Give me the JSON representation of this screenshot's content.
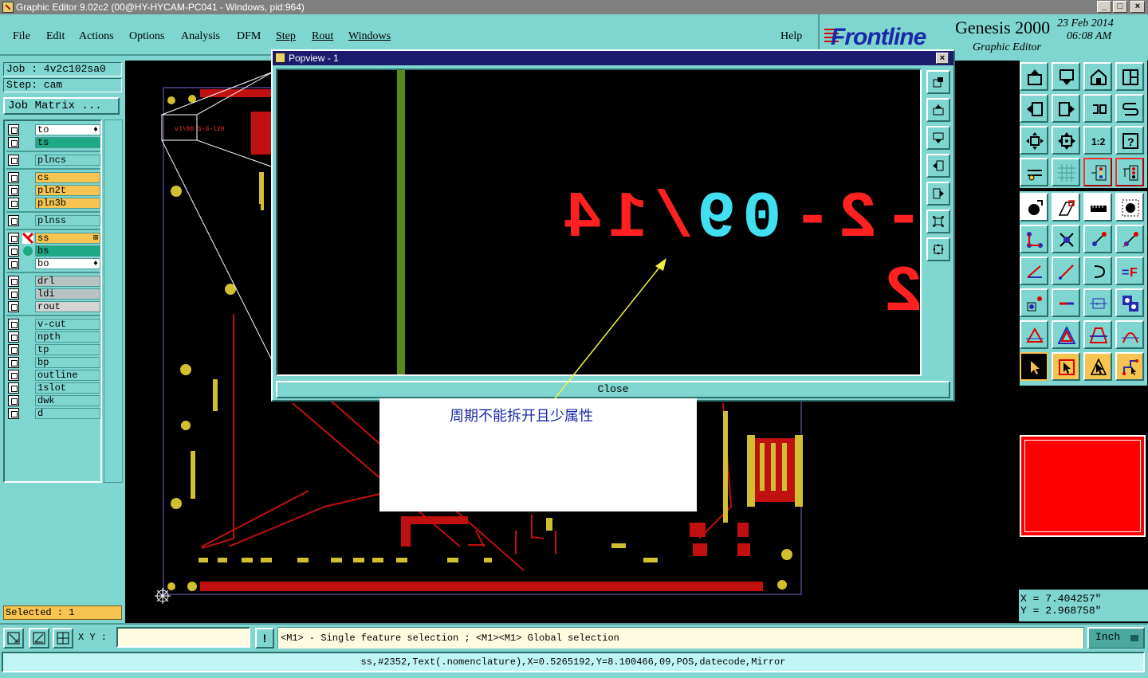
{
  "window": {
    "title": "Graphic Editor 9.02c2 (00@HY-HYCAM-PC041 - Windows, pid:964)",
    "minimize": "_",
    "maximize": "□",
    "close": "×"
  },
  "menu": {
    "items": [
      "File",
      "Edit",
      "Actions",
      "Options",
      "Analysis",
      "DFM",
      "Step",
      "Rout",
      "Windows"
    ],
    "help": "Help"
  },
  "brand": {
    "logo": "Frontline",
    "product": "Genesis 2000",
    "subtitle": "Graphic Editor",
    "date": "23 Feb 2014",
    "time": "06:08 AM"
  },
  "job": {
    "job_label": "Job : 4v2c102sa0",
    "step_label": "Step: cam",
    "matrix_button": "Job Matrix ..."
  },
  "layers": [
    {
      "name": "to",
      "color": "#ffffff",
      "end": "♦"
    },
    {
      "name": "ts",
      "color": "#1fa884",
      "end": ""
    },
    {
      "name": "plncs",
      "color": "#7fd6d0",
      "end": ""
    },
    {
      "name": "cs",
      "color": "#f5c451",
      "end": ""
    },
    {
      "name": "pln2t",
      "color": "#f5c451",
      "end": ""
    },
    {
      "name": "pln3b",
      "color": "#f5c451",
      "end": ""
    },
    {
      "name": "plnss",
      "color": "#7fd6d0",
      "end": ""
    },
    {
      "name": "ss",
      "color": "#f5c451",
      "end": "⊞"
    },
    {
      "name": "bs",
      "color": "#1fa884",
      "end": ""
    },
    {
      "name": "bo",
      "color": "#ffffff",
      "end": "♦"
    },
    {
      "name": "drl",
      "color": "#b8c4c4",
      "end": ""
    },
    {
      "name": "ldi",
      "color": "#b8c4c4",
      "end": ""
    },
    {
      "name": "rout",
      "color": "#d4d4d4",
      "end": ""
    },
    {
      "name": "v-cut",
      "color": "#7fd6d0",
      "end": ""
    },
    {
      "name": "npth",
      "color": "#7fd6d0",
      "end": ""
    },
    {
      "name": "tp",
      "color": "#7fd6d0",
      "end": ""
    },
    {
      "name": "bp",
      "color": "#7fd6d0",
      "end": ""
    },
    {
      "name": "outline",
      "color": "#7fd6d0",
      "end": ""
    },
    {
      "name": "1slot",
      "color": "#7fd6d0",
      "end": ""
    },
    {
      "name": "dwk",
      "color": "#7fd6d0",
      "end": ""
    },
    {
      "name": "d",
      "color": "#7fd6d0",
      "end": ""
    }
  ],
  "selected": "Selected : 1",
  "popview": {
    "title": "Popview - 1",
    "close_button": "Close",
    "text_red": "-2-2",
    "text_cyan": "09",
    "text_red2": "/14"
  },
  "note": {
    "text": "周期不能拆开且少属性"
  },
  "coords": {
    "x": "X = 7.404257\"",
    "y": "Y = 2.968758\""
  },
  "bottom": {
    "xy_label": "X Y :",
    "xy_value": "",
    "bang": "!",
    "message": "<M1> - Single feature selection ; <M1><M1> Global selection",
    "unit": "Inch"
  },
  "status": {
    "text": "ss,#2352,Text(.nomenclature),X=0.5265192,Y=8.100466,09,POS,datecode,Mirror"
  },
  "colors": {
    "accent": "#7fd6d0",
    "highlight": "#f5c451",
    "copper": "#ff0000",
    "cyan_text": "#40e0f0"
  }
}
